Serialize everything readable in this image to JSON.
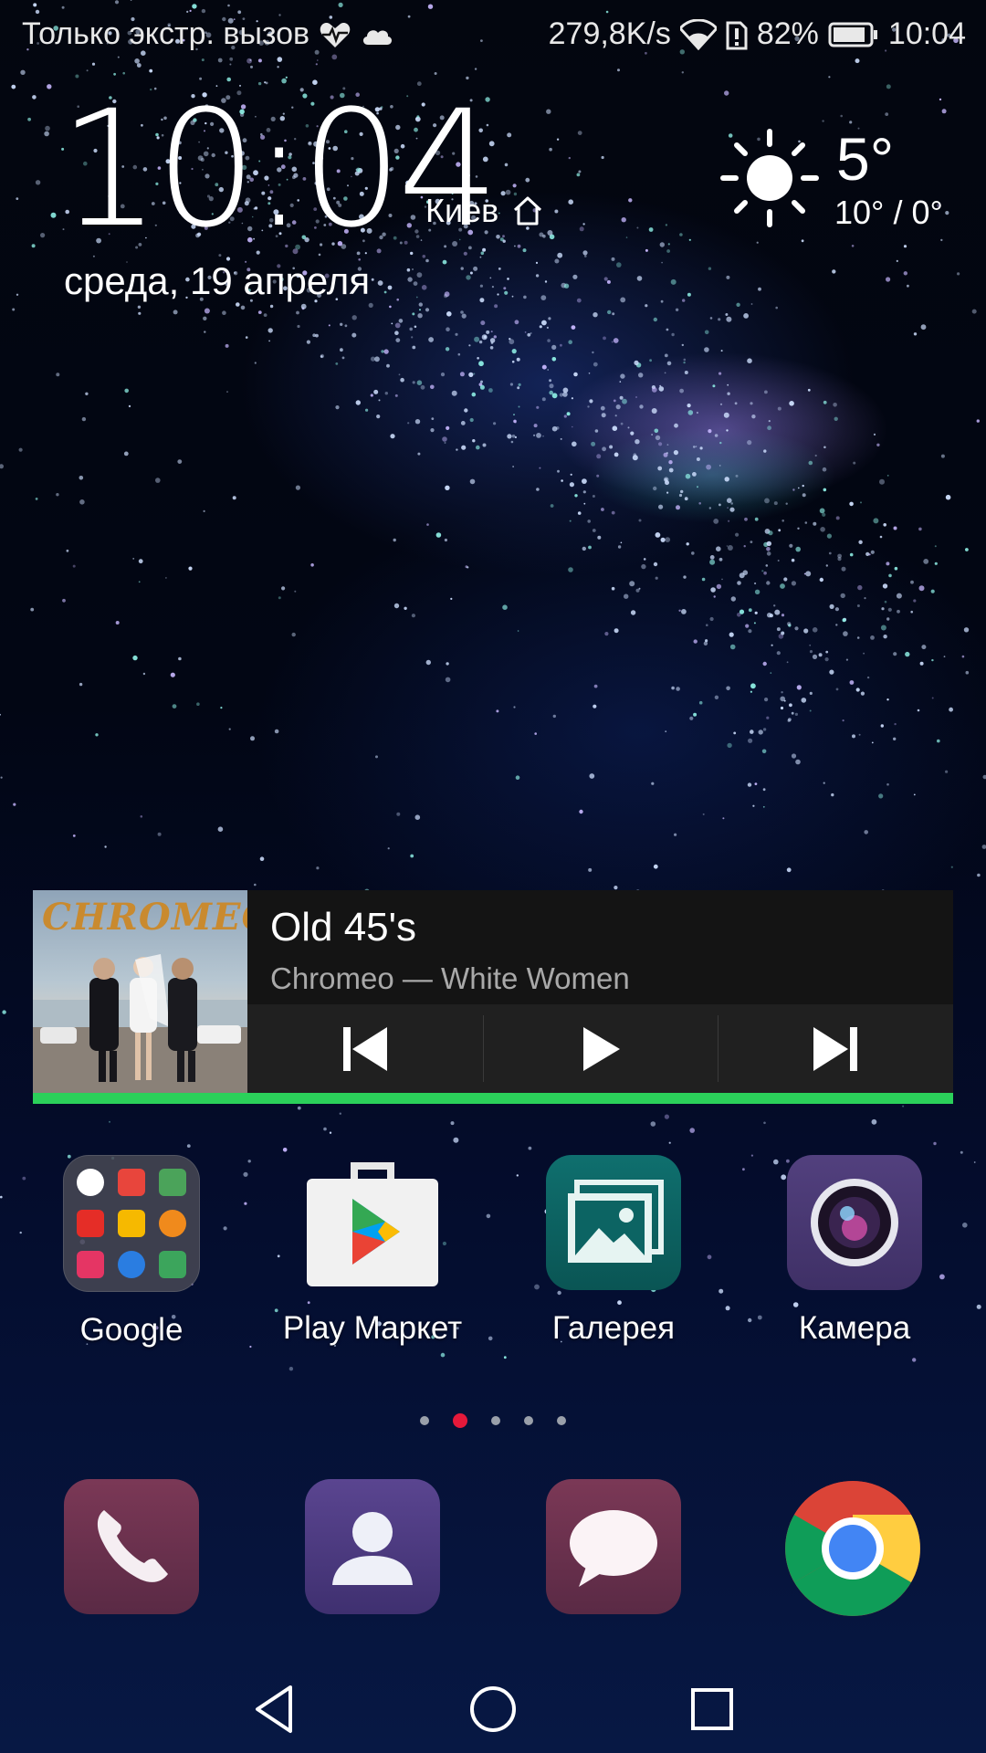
{
  "status_bar": {
    "carrier": "Только экстр. вызов",
    "net_speed": "279,8K/s",
    "battery": "82%",
    "time": "10:04",
    "icons": [
      "heart-monitor-icon",
      "cloud-icon",
      "wifi-icon",
      "battery-alert-icon",
      "battery-icon"
    ]
  },
  "clock_widget": {
    "time": "10:04",
    "city": "Киев",
    "date": "среда, 19 апреля"
  },
  "weather": {
    "icon": "sun-icon",
    "temp": "5°",
    "range": "10° / 0°"
  },
  "music_widget": {
    "album_art_text": "CHROMEO",
    "title": "Old 45's",
    "subtitle": "Chromeo — White Women",
    "progress_fraction": 1.0,
    "accent": "#2bd05a",
    "controls": [
      "previous-icon",
      "play-icon",
      "next-icon"
    ]
  },
  "apps": [
    {
      "label": "Google",
      "icon": "google-folder-icon"
    },
    {
      "label": "Play Маркет",
      "icon": "play-store-icon"
    },
    {
      "label": "Галерея",
      "icon": "gallery-icon"
    },
    {
      "label": "Камера",
      "icon": "camera-icon"
    }
  ],
  "page_indicator": {
    "count": 5,
    "active_index": 1,
    "active_color": "#e5193a"
  },
  "dock": [
    "phone-icon",
    "contacts-icon",
    "messages-icon",
    "chrome-icon"
  ],
  "nav_bar": [
    "back-icon",
    "home-icon",
    "recents-icon"
  ]
}
